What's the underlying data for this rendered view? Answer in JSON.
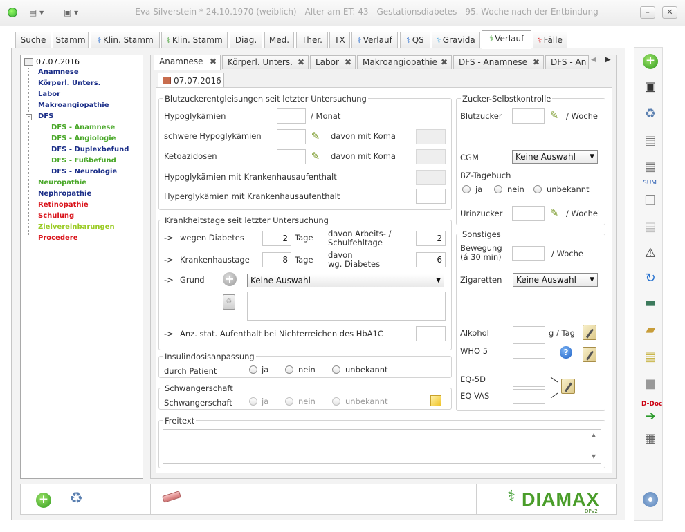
{
  "window": {
    "title": "Eva Silverstein  * 24.10.1970 (weiblich) - Alter am ET: 43 - Gestationsdiabetes - 95. Woche nach der Entbindung"
  },
  "main_tabs": [
    "Suche",
    "Stamm",
    "Klin. Stamm",
    "Klin. Stamm",
    "Diag.",
    "Med.",
    "Ther.",
    "TX",
    "Verlauf",
    "QS",
    "Gravida",
    "Verlauf",
    "Fälle"
  ],
  "tree": {
    "root": "07.07.2016",
    "items": [
      "Anamnese",
      "Körperl. Unters.",
      "Labor",
      "Makroangiopathie",
      "DFS",
      "DFS - Anamnese",
      "DFS - Angiologie",
      "DFS - Duplexbefund",
      "DFS - Fußbefund",
      "DFS - Neurologie",
      "Neuropathie",
      "Nephropathie",
      "Retinopathie",
      "Schulung",
      "Zielvereinbarungen",
      "Procedere"
    ],
    "colors": {
      "navy": "#1b2e88",
      "green": "#4aa82a",
      "red": "#d9141b",
      "lime": "#9acb24"
    }
  },
  "sub_tabs": [
    "Anamnese",
    "Körperl. Unters.",
    "Labor",
    "Makroangiopathie",
    "DFS - Anamnese",
    "DFS - An"
  ],
  "date_tab": "07.07.2016",
  "blutzucker": {
    "title": "Blutzuckerentgleisungen seit letzter Untersuchung",
    "hypo": "Hypoglykämien",
    "per_month": "/ Monat",
    "severe": "schwere Hypoglykämien",
    "koma1": "davon mit Koma",
    "keto": "Ketoazidosen",
    "koma2": "davon mit Koma",
    "hypo_kh": "Hypoglykämien mit Krankenhausaufenthalt",
    "hyper_kh": "Hyperglykämien mit Krankenhausaufenthalt"
  },
  "krank": {
    "title": "Krankheitstage seit letzter Untersuchung",
    "arrow": "->",
    "diabetes": "wegen Diabetes",
    "diabetes_val": "2",
    "tage1": "Tage",
    "arbeit": "davon Arbeits- /",
    "schul": "Schulfehltage",
    "arbeit_val": "2",
    "kh": "Krankenhaustage",
    "kh_val": "8",
    "tage2": "Tage",
    "davon": "davon",
    "wg": "wg. Diabetes",
    "wg_val": "6",
    "grund": "Grund",
    "grund_val": "Keine Auswahl",
    "stat": "Anz. stat. Aufenthalt bei Nichterreichen des HbA1C"
  },
  "insulin": {
    "title": "Insulindosisanpassung",
    "label": "durch Patient",
    "ja": "ja",
    "nein": "nein",
    "unbekannt": "unbekannt"
  },
  "schwanger": {
    "title": "Schwangerschaft",
    "label": "Schwangerschaft",
    "ja": "ja",
    "nein": "nein",
    "unbekannt": "unbekannt"
  },
  "freitext": {
    "title": "Freitext"
  },
  "zucker": {
    "title": "Zucker-Selbstkontrolle",
    "blutzucker": "Blutzucker",
    "woche1": "/ Woche",
    "cgm": "CGM",
    "cgm_val": "Keine Auswahl",
    "bz": "BZ-Tagebuch",
    "ja": "ja",
    "nein": "nein",
    "unbekannt": "unbekannt",
    "urin": "Urinzucker",
    "woche2": "/ Woche"
  },
  "sonstiges": {
    "title": "Sonstiges",
    "bewegung": "Bewegung",
    "bewegung2": "(á 30 min)",
    "woche": "/ Woche",
    "zigaretten": "Zigaretten",
    "zig_val": "Keine Auswahl",
    "alkohol": "Alkohol",
    "gtag": "g / Tag",
    "who": "WHO 5",
    "eq5d": "EQ-5D",
    "eqvas": "EQ VAS"
  },
  "toolbar": {
    "sum": "SUM",
    "ddoc": "D-Doc"
  },
  "logo": {
    "name": "DIAMAX",
    "sub": "DPV2"
  }
}
